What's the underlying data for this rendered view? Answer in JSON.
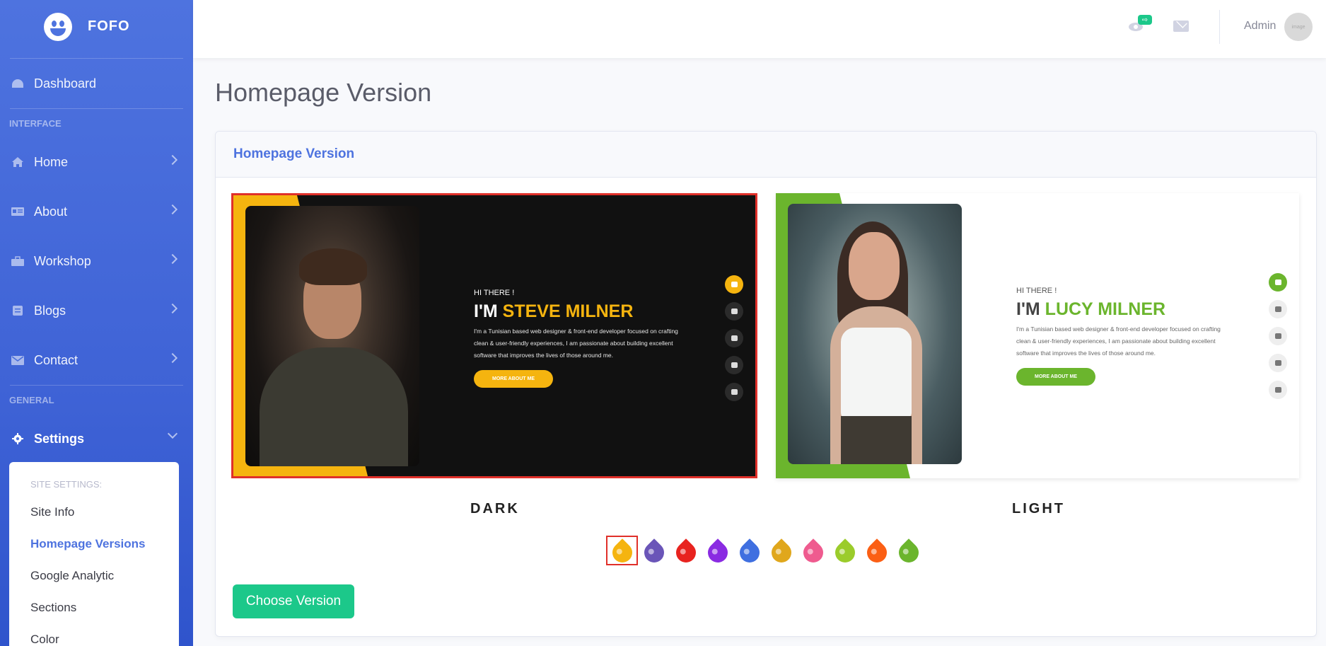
{
  "brand": {
    "name": "FOFO"
  },
  "sidebar": {
    "dashboard": "Dashboard",
    "interface_heading": "INTERFACE",
    "items": [
      {
        "label": "Home",
        "icon": "home-icon"
      },
      {
        "label": "About",
        "icon": "id-card-icon"
      },
      {
        "label": "Workshop",
        "icon": "briefcase-icon"
      },
      {
        "label": "Blogs",
        "icon": "file-icon"
      },
      {
        "label": "Contact",
        "icon": "envelope-icon"
      }
    ],
    "general_heading": "GENERAL",
    "settings": "Settings",
    "submenu": {
      "heading": "SITE SETTINGS:",
      "items": [
        "Site Info",
        "Homepage Versions",
        "Google Analytic",
        "Sections",
        "Color"
      ],
      "active": "Homepage Versions"
    }
  },
  "topbar": {
    "badge": "⇨",
    "user_name": "Admin",
    "avatar_text": "image"
  },
  "page": {
    "title": "Homepage Version",
    "card_title": "Homepage Version",
    "versions": [
      {
        "label": "DARK",
        "selected": true,
        "hi": "HI THERE !",
        "name_prefix": "I'M",
        "name": "STEVE MILNER",
        "desc": "I'm a Tunisian based web designer & front-end developer focused on crafting clean & user-friendly experiences, I am passionate about building excellent software that improves the lives of those around me.",
        "button": "MORE ABOUT ME",
        "accent": "#f5b40f"
      },
      {
        "label": "LIGHT",
        "selected": false,
        "hi": "HI THERE !",
        "name_prefix": "I'M",
        "name": "LUCY MILNER",
        "desc": "I'm a Tunisian based web designer & front-end developer focused on crafting clean & user-friendly experiences, I am passionate about building excellent software that improves the lives of those around me.",
        "button": "MORE ABOUT ME",
        "accent": "#6bb52d"
      }
    ],
    "colors": [
      "#f5b40f",
      "#6a55b8",
      "#e8231f",
      "#8a2be2",
      "#3f6fe0",
      "#e0a71c",
      "#ef5b8f",
      "#9bcc2b",
      "#fb5f14",
      "#6bb52d"
    ],
    "selected_color_index": 0,
    "choose_button": "Choose Version"
  }
}
